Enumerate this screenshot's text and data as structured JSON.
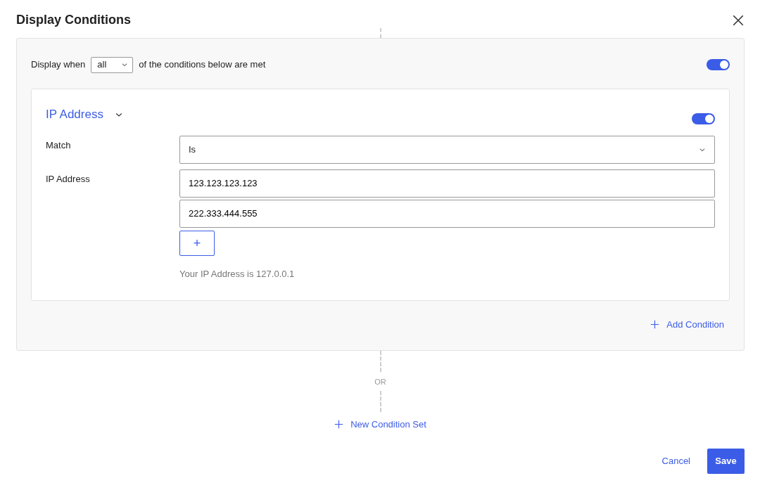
{
  "dialog": {
    "title": "Display Conditions"
  },
  "condition_set": {
    "prefix": "Display when",
    "quantifier": "all",
    "suffix": "of the conditions below are met",
    "enabled": true,
    "conditions": [
      {
        "title": "IP Address",
        "expanded": true,
        "enabled": true,
        "fields": [
          {
            "kind": "select",
            "label": "Match",
            "value": "Is"
          },
          {
            "kind": "list",
            "label": "IP Address",
            "values": [
              "123.123.123.123",
              "222.333.444.555"
            ],
            "add_label": "+",
            "hint": "Your IP Address is 127.0.0.1"
          }
        ]
      }
    ],
    "add_condition": "Add Condition"
  },
  "separator": "OR",
  "new_condition_set": "New Condition Set",
  "buttons": [
    {
      "kind": "link",
      "label": "Cancel"
    },
    {
      "kind": "primary",
      "label": "Save"
    }
  ]
}
